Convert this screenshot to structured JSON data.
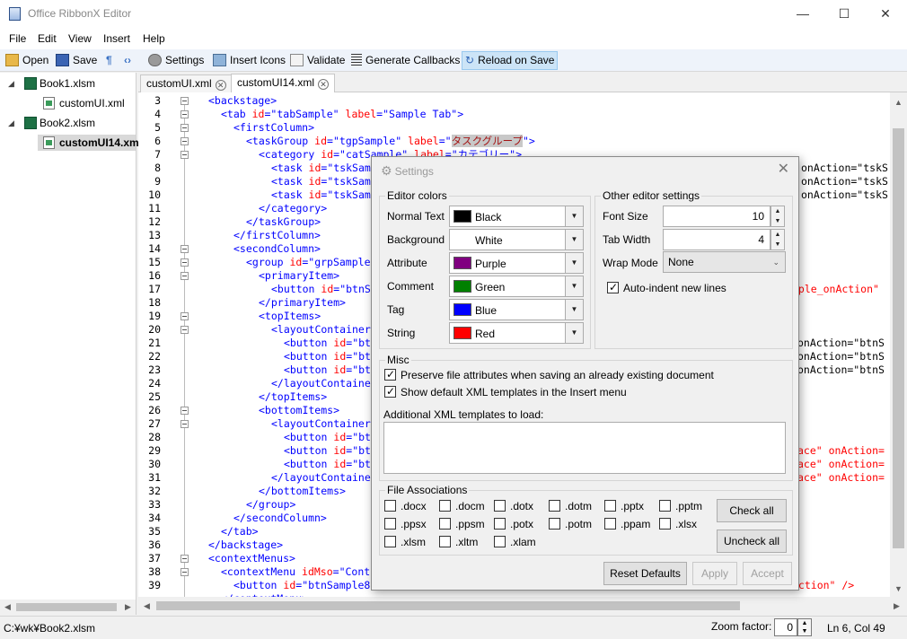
{
  "window": {
    "title": "Office RibbonX Editor",
    "min": "—",
    "max": "☐",
    "close": "✕"
  },
  "menu": [
    "File",
    "Edit",
    "View",
    "Insert",
    "Help"
  ],
  "toolbar": {
    "open": "Open",
    "save": "Save",
    "settings": "Settings",
    "insert_icons": "Insert Icons",
    "validate": "Validate",
    "generate_callbacks": "Generate Callbacks",
    "reload_on_save": "Reload on Save"
  },
  "tree": {
    "book1": "Book1.xlsm",
    "book1_child": "customUI.xml",
    "book2": "Book2.xlsm",
    "book2_child": "customUI14.xml"
  },
  "tabs": [
    {
      "label": "customUI.xml"
    },
    {
      "label": "customUI14.xml"
    }
  ],
  "editor": {
    "line_numbers": [
      "3",
      "4",
      "5",
      "6",
      "7",
      "8",
      "9",
      "10",
      "11",
      "12",
      "13",
      "14",
      "15",
      "16",
      "17",
      "18",
      "19",
      "20",
      "21",
      "22",
      "23",
      "24",
      "25",
      "26",
      "27",
      "28",
      "29",
      "30",
      "31",
      "32",
      "33",
      "34",
      "35",
      "36",
      "37",
      "38",
      "39"
    ],
    "right_fragments": [
      "onAction=\"tskS",
      "onAction=\"tskS",
      "onAction=\"tskS",
      "mple_onAction\"",
      "onAction=\"btnS",
      "onAction=\"btnS",
      "onAction=\"btnS",
      "ace\" onAction=",
      "ace\" onAction=",
      "ace\" onAction=",
      "Action\" />"
    ]
  },
  "status": {
    "path": "C:¥wk¥Book2.xlsm",
    "zoom_label": "Zoom factor:",
    "zoom_value": "0",
    "position": "Ln 6,  Col 49"
  },
  "dialog": {
    "title": "Settings",
    "close": "✕",
    "editor_colors": {
      "legend": "Editor colors",
      "rows": [
        {
          "label": "Normal Text",
          "value": "Black",
          "color": "#000000"
        },
        {
          "label": "Background",
          "value": "White",
          "color": "#ffffff"
        },
        {
          "label": "Attribute",
          "value": "Purple",
          "color": "#800080"
        },
        {
          "label": "Comment",
          "value": "Green",
          "color": "#008000"
        },
        {
          "label": "Tag",
          "value": "Blue",
          "color": "#0000ff"
        },
        {
          "label": "String",
          "value": "Red",
          "color": "#ff0000"
        }
      ]
    },
    "other": {
      "legend": "Other editor settings",
      "font_size_label": "Font Size",
      "font_size": "10",
      "tab_width_label": "Tab Width",
      "tab_width": "4",
      "wrap_mode_label": "Wrap Mode",
      "wrap_mode": "None",
      "auto_indent": "Auto-indent new lines"
    },
    "misc": {
      "legend": "Misc",
      "preserve": "Preserve file attributes when saving an already existing document",
      "show_templates": "Show default XML templates in the Insert menu",
      "additional_label": "Additional XML templates to load:"
    },
    "file_assoc": {
      "legend": "File Associations",
      "exts": [
        ".docx",
        ".docm",
        ".dotx",
        ".dotm",
        ".pptx",
        ".pptm",
        ".ppsx",
        ".ppsm",
        ".potx",
        ".potm",
        ".ppam",
        ".xlsx",
        ".xlsm",
        ".xltm",
        ".xlam"
      ],
      "check_all": "Check all",
      "uncheck_all": "Uncheck all"
    },
    "buttons": {
      "reset": "Reset Defaults",
      "apply": "Apply",
      "accept": "Accept"
    }
  }
}
